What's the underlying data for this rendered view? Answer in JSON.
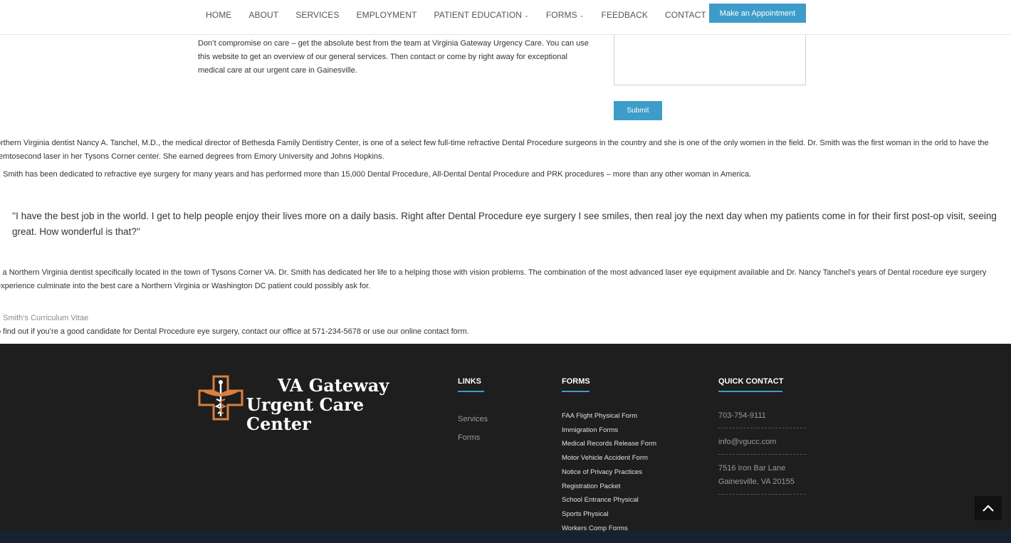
{
  "nav": {
    "items": [
      {
        "label": "HOME",
        "dropdown": false
      },
      {
        "label": "ABOUT",
        "dropdown": false
      },
      {
        "label": "SERVICES",
        "dropdown": false
      },
      {
        "label": "EMPLOYMENT",
        "dropdown": false
      },
      {
        "label": "PATIENT EDUCATION",
        "dropdown": true
      },
      {
        "label": "FORMS",
        "dropdown": true
      },
      {
        "label": "FEEDBACK",
        "dropdown": false
      },
      {
        "label": "CONTACT",
        "dropdown": false
      }
    ],
    "appointment_label": "Make an Appointment"
  },
  "intro": {
    "text": "Don’t compromise on care – get the absolute best from the team at Virginia Gateway Urgency Care. You can use this website to get an overview of our general services. Then contact or come by right away for exceptional medical care at our urgent care in Gainesville."
  },
  "form": {
    "submit_label": "Submit"
  },
  "content": {
    "bio1": "orthern Virginia dentist Nancy A. Tanchel, M.D., the medical director of Bethesda Family Dentistry Center, is one of a select few full-time refractive Dental Procedure surgeons in the country and she is one of the only women in the field. Dr. Smith was the first woman in the orld to have the femtosecond laser in her Tysons Corner center. She earned degrees from Emory University and Johns Hopkins.",
    "bio2": "r. Smith has been dedicated to refractive eye surgery for many years and has performed more than 15,000 Dental Procedure, All-Dental Dental Procedure and PRK procedures – more than any other woman in America.",
    "quote": "''I have the best job in the world. I get to help people enjoy their lives more on a daily basis. Right after Dental Procedure eye surgery I see smiles, then real joy the next day when my patients come in for their first post-op visit, seeing great. How wonderful is that?''",
    "bio3": "s a Northern Virginia dentist specifically located in the town of Tysons Corner VA. Dr. Smith has dedicated her life to a helping those with vision problems. The combination of the most advanced laser eye equipment available and Dr. Nancy Tanchel’s years of Dental rocedure eye surgery experience culminate into the best care a Northern Virginia or Washington DC patient could possibly ask for.",
    "cv_link": "r. Smith’s Curriculum Vitae",
    "contact_line": "o find out if you’re a good candidate for Dental Procedure eye surgery, contact our office at 571-234-5678 or use our online contact form."
  },
  "footer": {
    "logo_line1": "VA Gateway",
    "logo_line2": "Urgent Care Center",
    "links_heading": "LINKS",
    "links": [
      "Services",
      "Forms"
    ],
    "forms_heading": "FORMS",
    "forms": [
      "FAA Flight Physical Form",
      "Immigration Forms",
      "Medical Records Release Form",
      "Motor Vehicle Accident Form",
      "Notice of Privacy Practices",
      "Registration Packet",
      "School Entrance Physical",
      "Sports Physical",
      "Workers Comp Forms"
    ],
    "quick_contact_heading": "QUICK CONTACT",
    "phone": "703-754-9111",
    "email": "info@vgucc.com",
    "address_line1": "7516 Iron Bar Lane",
    "address_line2": "Gainesville, VA 20155"
  },
  "icons": {
    "logo": "caduceus-cross-logo",
    "dropdown": "chevron-down-icon",
    "back_to_top": "chevron-up-icon"
  },
  "colors": {
    "accent": "#3d9cc9",
    "footer_bg": "#1e1e1e",
    "logo_orange": "#d9803f"
  }
}
